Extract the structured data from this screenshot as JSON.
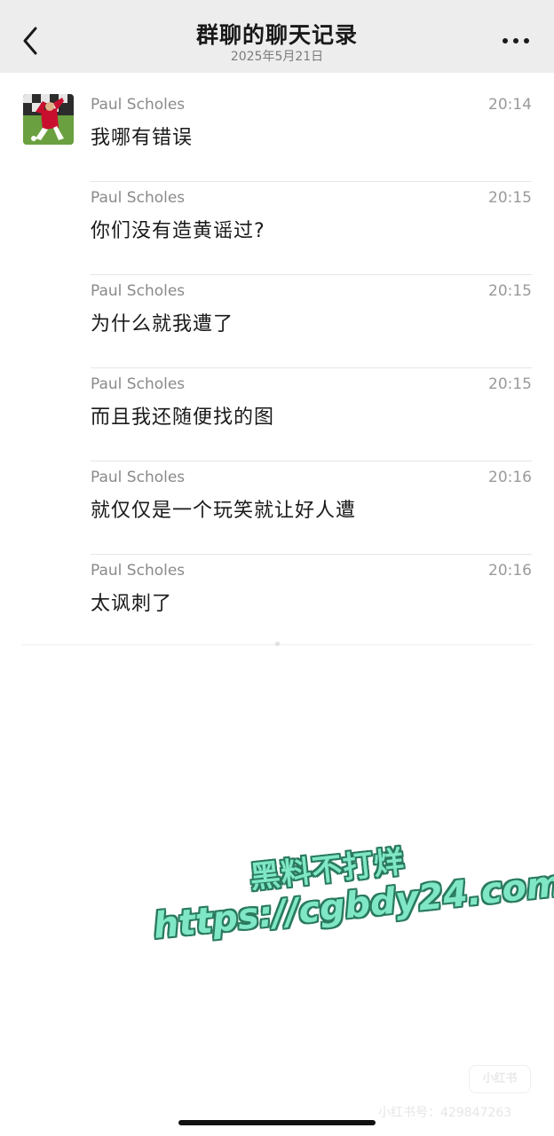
{
  "header": {
    "title": "群聊的聊天记录",
    "subtitle": "2025年5月21日",
    "back_icon": "chevron-left-icon",
    "more_icon": "more-horizontal-icon"
  },
  "messages": [
    {
      "sender": "Paul Scholes",
      "time": "20:14",
      "text": "我哪有错误"
    },
    {
      "sender": "Paul Scholes",
      "time": "20:15",
      "text": "你们没有造黄谣过?"
    },
    {
      "sender": "Paul Scholes",
      "time": "20:15",
      "text": "为什么就我遭了"
    },
    {
      "sender": "Paul Scholes",
      "time": "20:15",
      "text": "而且我还随便找的图"
    },
    {
      "sender": "Paul Scholes",
      "time": "20:16",
      "text": "就仅仅是一个玩笑就让好人遭"
    },
    {
      "sender": "Paul Scholes",
      "time": "20:16",
      "text": "太讽刺了"
    }
  ],
  "watermark": {
    "line1": "黑料不打烊",
    "line2": "https://cgbdy24.com"
  },
  "footer": {
    "badge": "小红书",
    "id_text": "小红书号：429847263"
  },
  "colors": {
    "header_bg": "#ededed",
    "watermark_fill": "#7fe7c6",
    "watermark_stroke": "#2a7a5e"
  }
}
